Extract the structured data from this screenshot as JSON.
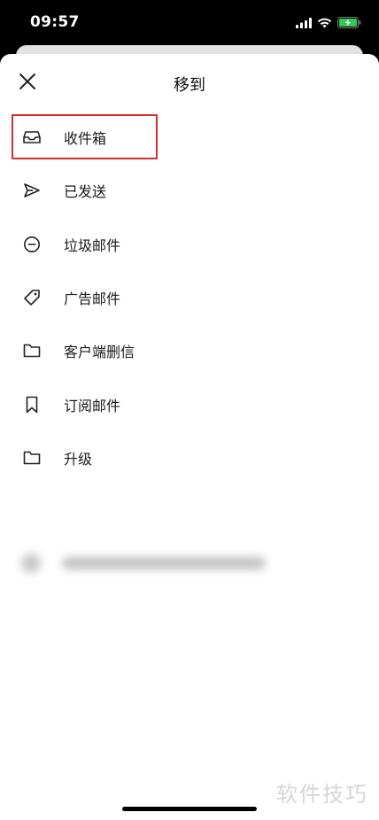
{
  "status_bar": {
    "time": "09:57",
    "icons": [
      "signal-icon",
      "wifi-icon",
      "battery-charging-icon"
    ],
    "battery_color": "#34c759"
  },
  "sheet": {
    "title": "移到",
    "close_icon": "close-icon"
  },
  "folders": [
    {
      "label": "收件箱",
      "icon": "inbox-icon",
      "selected": true
    },
    {
      "label": "已发送",
      "icon": "send-icon",
      "selected": false
    },
    {
      "label": "垃圾邮件",
      "icon": "spam-icon",
      "selected": false
    },
    {
      "label": "广告邮件",
      "icon": "tag-icon",
      "selected": false
    },
    {
      "label": "客户端删信",
      "icon": "folder-icon",
      "selected": false
    },
    {
      "label": "订阅邮件",
      "icon": "bookmark-icon",
      "selected": false
    },
    {
      "label": "升级",
      "icon": "folder-icon",
      "selected": false
    }
  ],
  "highlight_color": "#d32f2f",
  "watermark": "软件技巧"
}
